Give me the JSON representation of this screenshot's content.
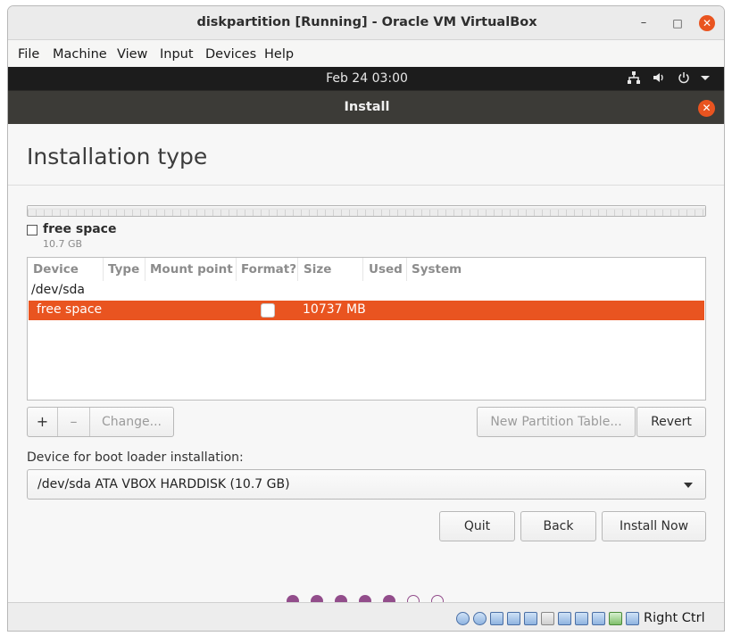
{
  "window": {
    "title": "diskpartition [Running] - Oracle VM VirtualBox",
    "minimize": "–",
    "maximize": "□",
    "close": "✕"
  },
  "menu": [
    "File",
    "Machine",
    "View",
    "Input",
    "Devices",
    "Help"
  ],
  "guest_topbar": {
    "clock": "Feb 24  03:00",
    "icons": [
      "network-icon",
      "volume-icon",
      "power-icon",
      "menu-arrow-icon"
    ]
  },
  "installer": {
    "header_title": "Install",
    "close": "✕",
    "page_title": "Installation type",
    "disk_legend": {
      "label": "free space",
      "size": "10.7 GB"
    },
    "table": {
      "columns": [
        "Device",
        "Type",
        "Mount point",
        "Format?",
        "Size",
        "Used",
        "System"
      ],
      "device": "/dev/sda",
      "selected_row": {
        "device": "free space",
        "format": false,
        "size": "10737 MB"
      }
    },
    "buttons": {
      "add": "+",
      "remove": "–",
      "change": "Change...",
      "new_partition_table": "New Partition Table...",
      "revert": "Revert",
      "quit": "Quit",
      "back": "Back",
      "install_now": "Install Now"
    },
    "boot_loader": {
      "label": "Device for boot loader installation:",
      "value": "/dev/sda ATA VBOX HARDDISK (10.7 GB)"
    },
    "progress": {
      "total_steps": 7,
      "completed_steps": 5
    }
  },
  "statusbar": {
    "host_key": "Right Ctrl"
  },
  "colors": {
    "accent": "#e95420",
    "progress_filled": "#924d8b",
    "header_dark": "#3c3b37",
    "topbar": "#1c1c1c"
  }
}
